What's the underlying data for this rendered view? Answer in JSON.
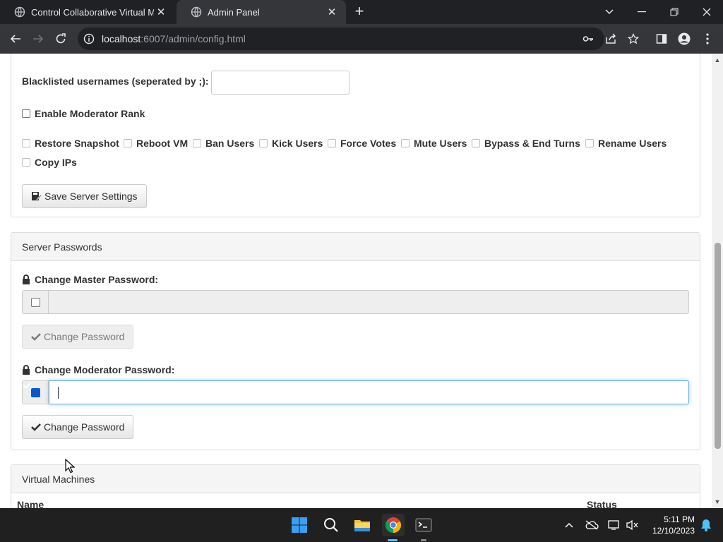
{
  "browser": {
    "tabs": [
      {
        "title": "Control Collaborative Virtual Ma",
        "active": false
      },
      {
        "title": "Admin Panel",
        "active": true
      }
    ],
    "url_host": "localhost",
    "url_rest": ":6007/admin/config.html"
  },
  "server_settings": {
    "blacklist_label": "Blacklisted usernames (seperated by ;):",
    "blacklist_value": "",
    "enable_mod_label": "Enable Moderator Rank",
    "permissions": [
      {
        "label": "Restore Snapshot",
        "checked": false
      },
      {
        "label": "Reboot VM",
        "checked": false
      },
      {
        "label": "Ban Users",
        "checked": false
      },
      {
        "label": "Kick Users",
        "checked": false
      },
      {
        "label": "Force Votes",
        "checked": false
      },
      {
        "label": "Mute Users",
        "checked": false
      },
      {
        "label": "Bypass & End Turns",
        "checked": false
      },
      {
        "label": "Rename Users",
        "checked": false
      },
      {
        "label": "Copy IPs",
        "checked": false
      }
    ],
    "save_label": "Save Server Settings"
  },
  "server_passwords": {
    "heading": "Server Passwords",
    "master_label": "Change Master Password:",
    "master_enabled": false,
    "master_button": "Change Password",
    "mod_label": "Change Moderator Password:",
    "mod_enabled": true,
    "mod_button": "Change Password"
  },
  "virtual_machines": {
    "heading": "Virtual Machines",
    "columns": [
      "Name",
      "Status"
    ]
  },
  "taskbar": {
    "time": "5:11 PM",
    "date": "12/10/2023"
  },
  "colors": {
    "focus_border": "#66afe9",
    "checkbox_checked": "#0b57d0",
    "chrome_dark": "#202124"
  }
}
